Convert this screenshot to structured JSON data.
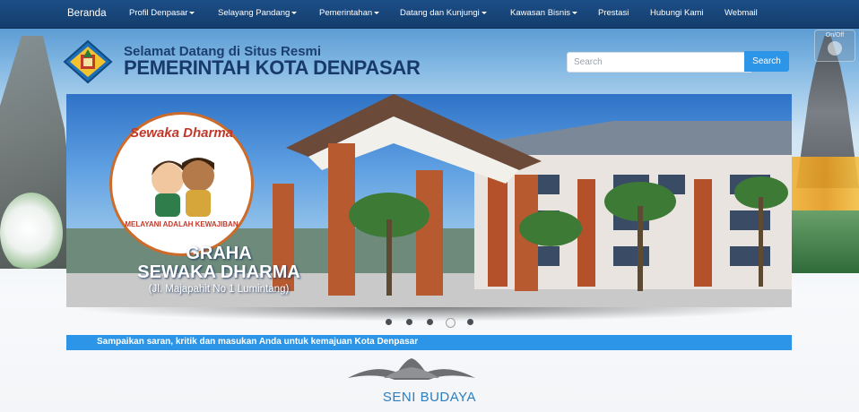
{
  "nav": {
    "items": [
      {
        "label": "Beranda",
        "dropdown": false
      },
      {
        "label": "Profil Denpasar",
        "dropdown": true
      },
      {
        "label": "Selayang Pandang",
        "dropdown": true
      },
      {
        "label": "Pemerintahan",
        "dropdown": true
      },
      {
        "label": "Datang dan Kunjungi",
        "dropdown": true
      },
      {
        "label": "Kawasan Bisnis",
        "dropdown": true
      },
      {
        "label": "Prestasi",
        "dropdown": false
      },
      {
        "label": "Hubungi Kami",
        "dropdown": false
      },
      {
        "label": "Webmail",
        "dropdown": false
      }
    ]
  },
  "toggle": {
    "label": "On/Off"
  },
  "header": {
    "welcome": "Selamat Datang di Situs Resmi",
    "title": "PEMERINTAH KOTA DENPASAR"
  },
  "search": {
    "placeholder": "Search",
    "button_label": "Search"
  },
  "slider": {
    "badge_top": "Sewaka Dharma",
    "badge_bottom": "MELAYANI ADALAH KEWAJIBAN",
    "title_line1": "GRAHA",
    "title_line2": "SEWAKA DHARMA",
    "address": "(Jl. Majapahit No 1 Lumintang)",
    "slide_count": 5,
    "active_index": 3
  },
  "marquee": {
    "text": "Sampaikan saran, kritik dan masukan Anda untuk kemajuan Kota Denpasar"
  },
  "section": {
    "title": "SENI BUDAYA"
  },
  "colors": {
    "nav": "#1c4e86",
    "accent": "#2c95e8",
    "title": "#173a6a"
  }
}
